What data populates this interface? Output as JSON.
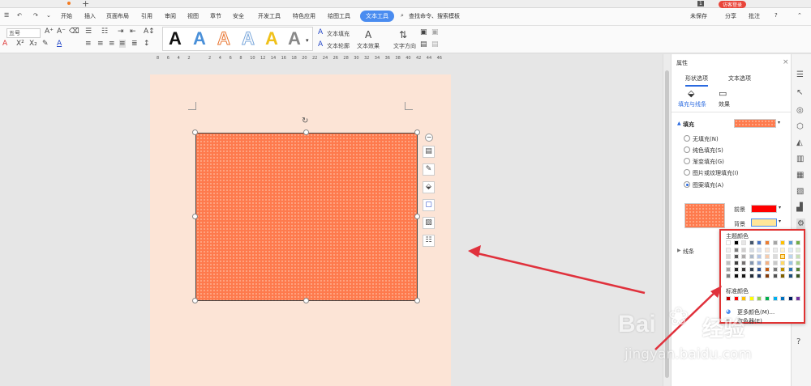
{
  "menubar": {
    "tabs": [
      "开始",
      "插入",
      "页面布局",
      "引用",
      "审阅",
      "视图",
      "章节",
      "安全",
      "开发工具",
      "特色应用",
      "绘图工具"
    ],
    "active_tab": "文本工具",
    "search_placeholder": "查找命令、搜索模板",
    "login": "访客登录",
    "page_badge": "1",
    "unsaved": "未保存",
    "share": "分享",
    "comment": "批注"
  },
  "toolbar": {
    "font_size": "五号",
    "text_fill": "文本填充",
    "text_outline": "文本轮廓",
    "text_effect": "文本效果",
    "text_direction": "文字方向",
    "style_letter": "A"
  },
  "ruler": [
    "8",
    "6",
    "4",
    "2",
    "",
    "2",
    "4",
    "6",
    "8",
    "10",
    "12",
    "14",
    "16",
    "18",
    "20",
    "22",
    "24",
    "26",
    "28",
    "30",
    "32",
    "34",
    "36",
    "38",
    "40",
    "42",
    "44",
    "46"
  ],
  "panel": {
    "title": "属性",
    "tab_shape": "形状选项",
    "tab_text": "文本选项",
    "sub_fill": "填充与线条",
    "sub_effect": "效果",
    "section_fill": "填充",
    "options": [
      "无填充(N)",
      "纯色填充(S)",
      "渐变填充(G)",
      "图片或纹理填充(I)",
      "图案填充(A)"
    ],
    "fg_label": "前景",
    "bg_label": "背景",
    "line_label": "线条"
  },
  "popup": {
    "theme_title": "主题颜色",
    "standard_title": "标准颜色",
    "more_colors": "更多颜色(M)...",
    "eyedropper": "取色器(E)"
  },
  "colors": {
    "shape_fill": "#fe7a4d",
    "page_bg": "#fce4d6",
    "foreground": "#ff0000",
    "background": "#ffe699",
    "accent": "#4a8cf0",
    "arrow": "#e0313c"
  },
  "watermark": {
    "brand": "Bai",
    "brand2": "经验",
    "url": "jingyan.baidu.com"
  }
}
